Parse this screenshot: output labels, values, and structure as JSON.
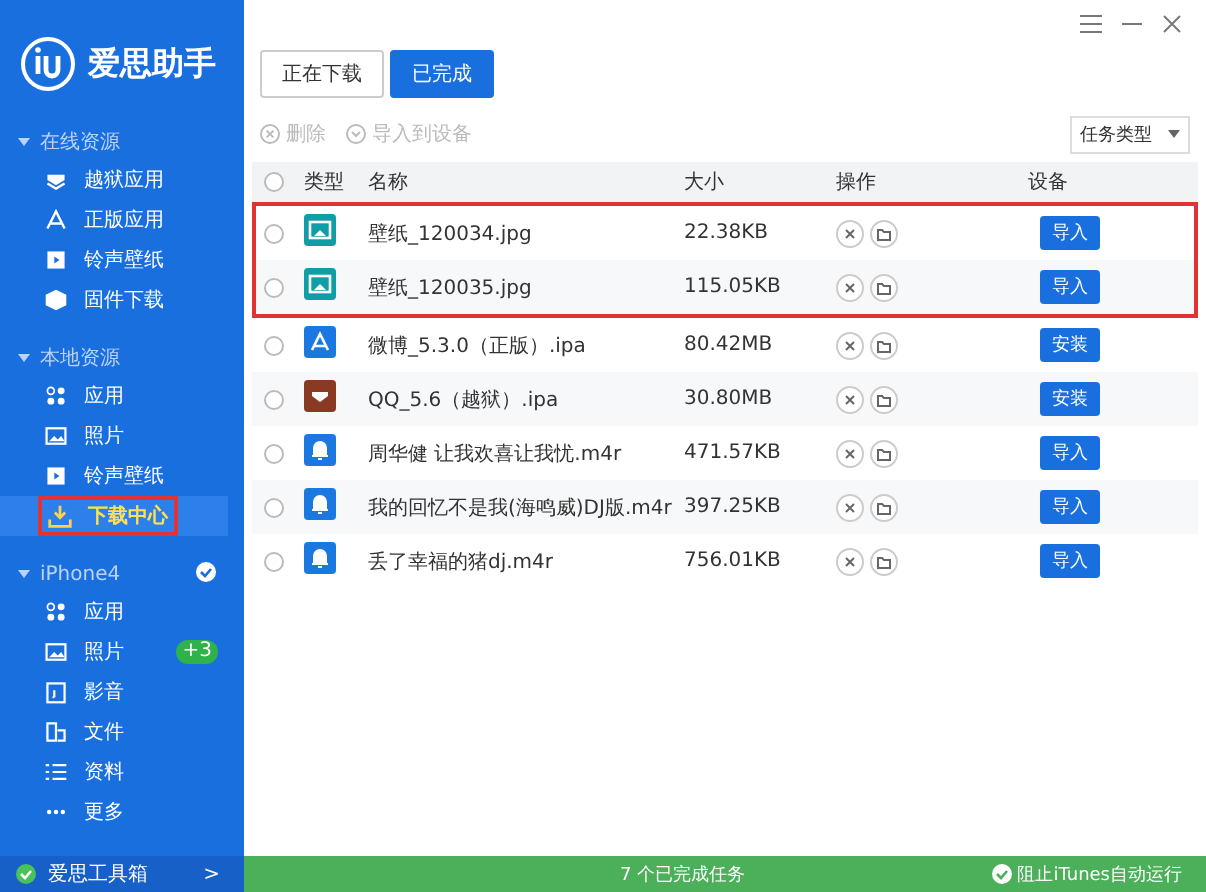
{
  "sidebar": {
    "logo_text": "爱思助手",
    "groups": [
      {
        "label": "在线资源",
        "expanded": true,
        "connected": false,
        "items": [
          {
            "label": "越狱应用",
            "selected": false,
            "highlighted": false
          },
          {
            "label": "正版应用",
            "selected": false,
            "highlighted": false
          },
          {
            "label": "铃声壁纸",
            "selected": false,
            "highlighted": false
          },
          {
            "label": "固件下载",
            "selected": false,
            "highlighted": false
          }
        ]
      },
      {
        "label": "本地资源",
        "expanded": true,
        "connected": false,
        "items": [
          {
            "label": "应用",
            "selected": false,
            "highlighted": false
          },
          {
            "label": "照片",
            "selected": false,
            "highlighted": false
          },
          {
            "label": "铃声壁纸",
            "selected": false,
            "highlighted": false
          },
          {
            "label": "下载中心",
            "selected": true,
            "highlighted": true
          }
        ]
      },
      {
        "label": "iPhone4",
        "expanded": true,
        "connected": true,
        "items": [
          {
            "label": "应用",
            "selected": false,
            "highlighted": false
          },
          {
            "label": "照片",
            "selected": false,
            "highlighted": false,
            "badge": "+3"
          },
          {
            "label": "影音",
            "selected": false,
            "highlighted": false
          },
          {
            "label": "文件",
            "selected": false,
            "highlighted": false
          },
          {
            "label": "资料",
            "selected": false,
            "highlighted": false
          },
          {
            "label": "更多",
            "selected": false,
            "highlighted": false
          }
        ]
      }
    ],
    "footer": {
      "label": "爱思工具箱",
      "arrow": ">"
    }
  },
  "tabs": [
    {
      "label": "正在下载",
      "selected": false
    },
    {
      "label": "已完成",
      "selected": true
    }
  ],
  "toolbar": {
    "actions": [
      {
        "label": "删除",
        "disabled": true
      },
      {
        "label": "导入到设备",
        "disabled": true
      }
    ],
    "filter": {
      "value": "任务类型"
    }
  },
  "table": {
    "all_selected": false,
    "columns": [
      "类型",
      "名称",
      "大小",
      "操作",
      "设备"
    ],
    "rows": [
      {
        "kind": "image",
        "name": "壁纸_120034.jpg",
        "size": "22.38KB",
        "action": "导入",
        "selected": false,
        "highlighted": true
      },
      {
        "kind": "image",
        "name": "壁纸_120035.jpg",
        "size": "115.05KB",
        "action": "导入",
        "selected": false,
        "highlighted": true
      },
      {
        "kind": "app",
        "name": "微博_5.3.0（正版）.ipa",
        "size": "80.42MB",
        "action": "安装",
        "selected": false,
        "highlighted": false
      },
      {
        "kind": "jailbreak",
        "name": "QQ_5.6（越狱）.ipa",
        "size": "30.80MB",
        "action": "安装",
        "selected": false,
        "highlighted": false
      },
      {
        "kind": "ringtone",
        "name": "周华健 让我欢喜让我忧.m4r",
        "size": "471.57KB",
        "action": "导入",
        "selected": false,
        "highlighted": false
      },
      {
        "kind": "ringtone",
        "name": "我的回忆不是我(海鸣威)DJ版.m4r",
        "size": "397.25KB",
        "action": "导入",
        "selected": false,
        "highlighted": false
      },
      {
        "kind": "ringtone",
        "name": "丢了幸福的猪dj.m4r",
        "size": "756.01KB",
        "action": "导入",
        "selected": false,
        "highlighted": false
      }
    ]
  },
  "status_bar": {
    "summary": "7 个已完成任务",
    "itunes": {
      "label": "阻止iTunes自动运行",
      "checked": true
    }
  }
}
